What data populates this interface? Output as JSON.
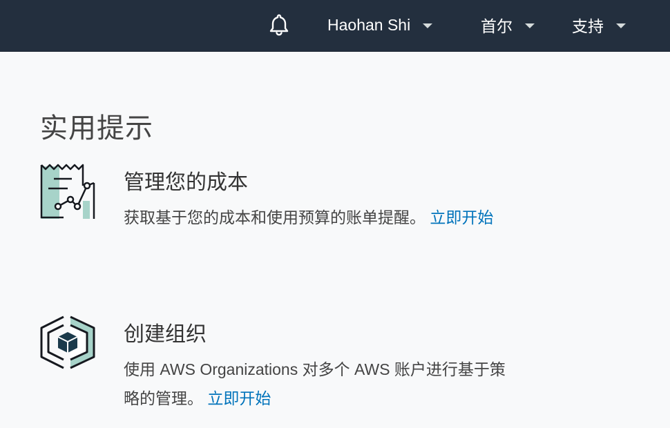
{
  "header": {
    "notifications_icon": "bell-icon",
    "user_menu_label": "Haohan Shi",
    "region_menu_label": "首尔",
    "support_menu_label": "支持",
    "background_color": "#232f3e"
  },
  "main": {
    "section_title": "实用提示",
    "tips": [
      {
        "icon": "billing-chart-icon",
        "title": "管理您的成本",
        "description": "获取基于您的成本和使用预算的账单提醒。",
        "link_label": "立即开始"
      },
      {
        "icon": "organizations-icon",
        "title": "创建组织",
        "description": "使用 AWS Organizations 对多个 AWS 账户进行基于策略的管理。",
        "link_label": "立即开始"
      }
    ],
    "link_color": "#0073bb",
    "icon_accent_color": "#a7d3c9"
  }
}
